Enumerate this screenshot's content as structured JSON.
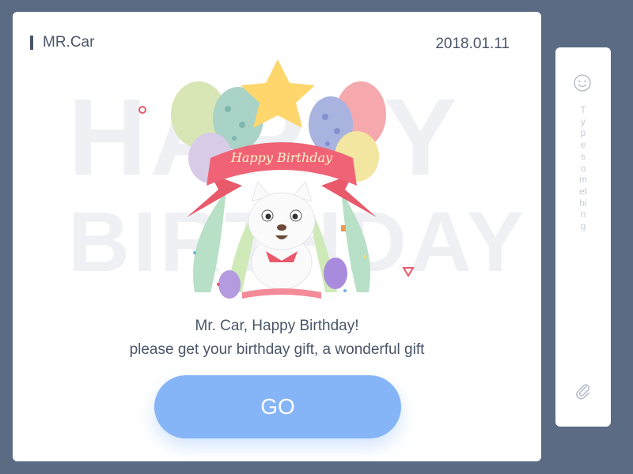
{
  "card": {
    "sender": "MR.Car",
    "date": "2018.01.11",
    "watermark_line1": "HAPPY",
    "watermark_line2": "BIRTHDAY",
    "banner_text": "Happy Birthday",
    "message_line1": "Mr. Car, Happy Birthday!",
    "message_line2": "please get your birthday gift, a wonderful gift",
    "go_label": "GO"
  },
  "sidebar": {
    "emoji_icon": "smiley-face-icon",
    "placeholder": "Type something",
    "attach_icon": "paperclip-icon"
  },
  "colors": {
    "background": "#5a6b83",
    "accent": "#85b5f7",
    "text": "#4a5568"
  }
}
